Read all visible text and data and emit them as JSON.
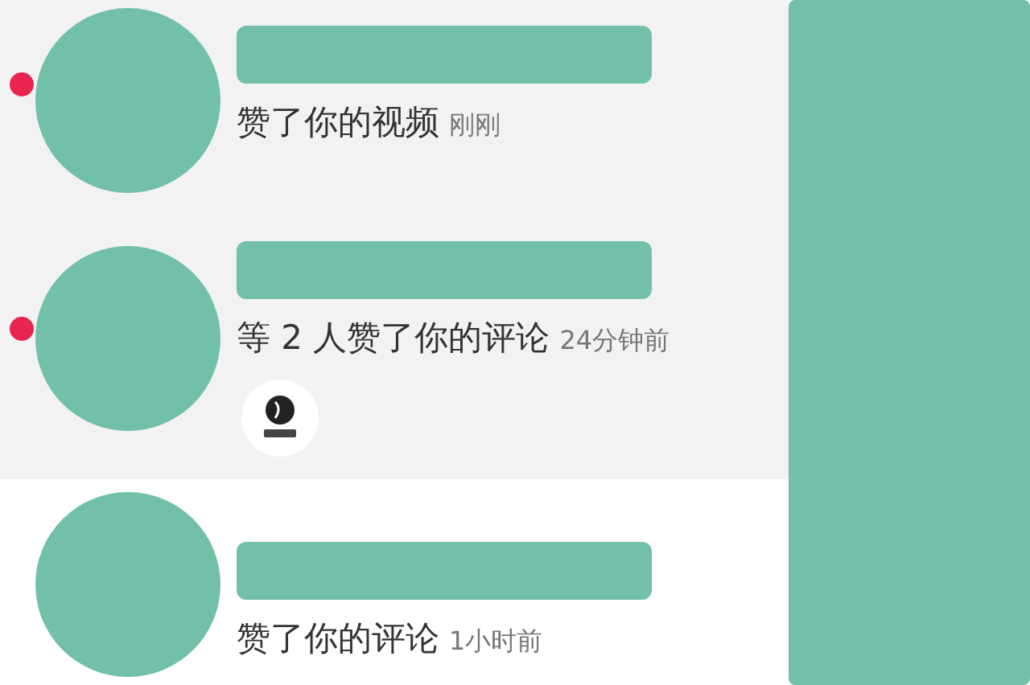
{
  "notifications": [
    {
      "unread": true,
      "action": "赞了你的视频",
      "time": "刚刚"
    },
    {
      "unread": true,
      "action": "等 2 人赞了你的评论",
      "time": "24分钟前",
      "thumbnail": true
    },
    {
      "unread": false,
      "action": "赞了你的评论",
      "time": "1小时前"
    }
  ]
}
